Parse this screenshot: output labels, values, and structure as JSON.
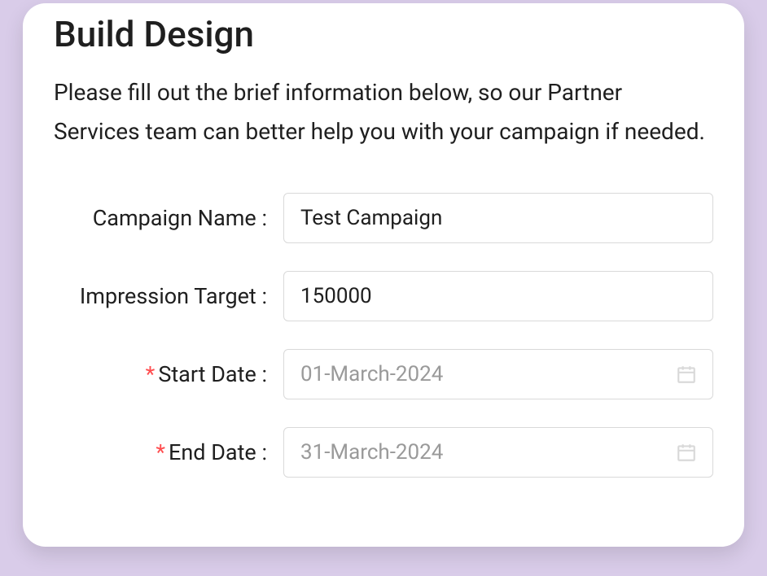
{
  "title": "Build Design",
  "description": "Please fill out the brief information below, so our Partner Services team can better help you with your campaign if needed.",
  "form": {
    "campaign_name": {
      "label": "Campaign Name :",
      "value": "Test Campaign",
      "required": false
    },
    "impression_target": {
      "label": "Impression Target :",
      "value": "150000",
      "required": false
    },
    "start_date": {
      "label": "Start Date :",
      "value": "01-March-2024",
      "required": true
    },
    "end_date": {
      "label": "End Date :",
      "value": "31-March-2024",
      "required": true
    }
  }
}
